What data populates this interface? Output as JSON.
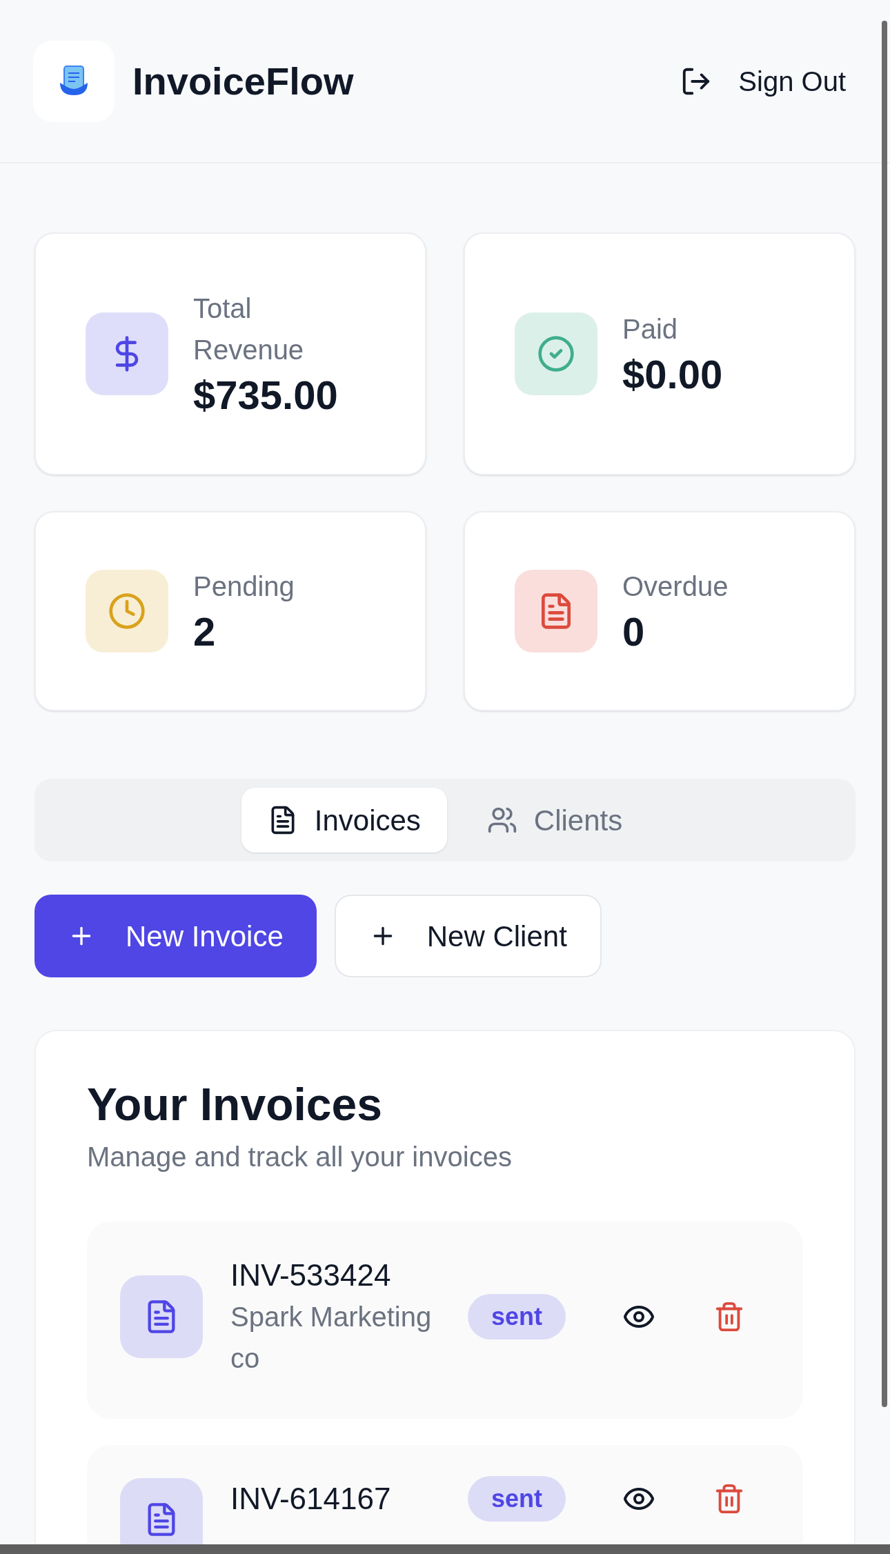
{
  "header": {
    "app_name": "InvoiceFlow",
    "sign_out": "Sign Out"
  },
  "stats": [
    {
      "kind": "revenue",
      "label": "Total Revenue",
      "value": "$735.00",
      "color": "#4f46e5"
    },
    {
      "kind": "paid",
      "label": "Paid",
      "value": "$0.00",
      "color": "#3fae8c"
    },
    {
      "kind": "pending",
      "label": "Pending",
      "value": "2",
      "color": "#d9a21b"
    },
    {
      "kind": "overdue",
      "label": "Overdue",
      "value": "0",
      "color": "#dc4a3d"
    }
  ],
  "tabs": [
    {
      "kind": "invoices",
      "label": "Invoices",
      "selected": true
    },
    {
      "kind": "clients",
      "label": "Clients",
      "selected": false
    }
  ],
  "actions": [
    {
      "label": "New Invoice",
      "primary": true
    },
    {
      "label": "New Client",
      "primary": false
    }
  ],
  "invoices": {
    "title": "Your Invoices",
    "subtitle": "Manage and track all your invoices",
    "rows": [
      {
        "number": "INV-533424",
        "client": "Spark Marketing co",
        "status": "sent"
      },
      {
        "number": "INV-614167",
        "status": "sent"
      }
    ]
  }
}
